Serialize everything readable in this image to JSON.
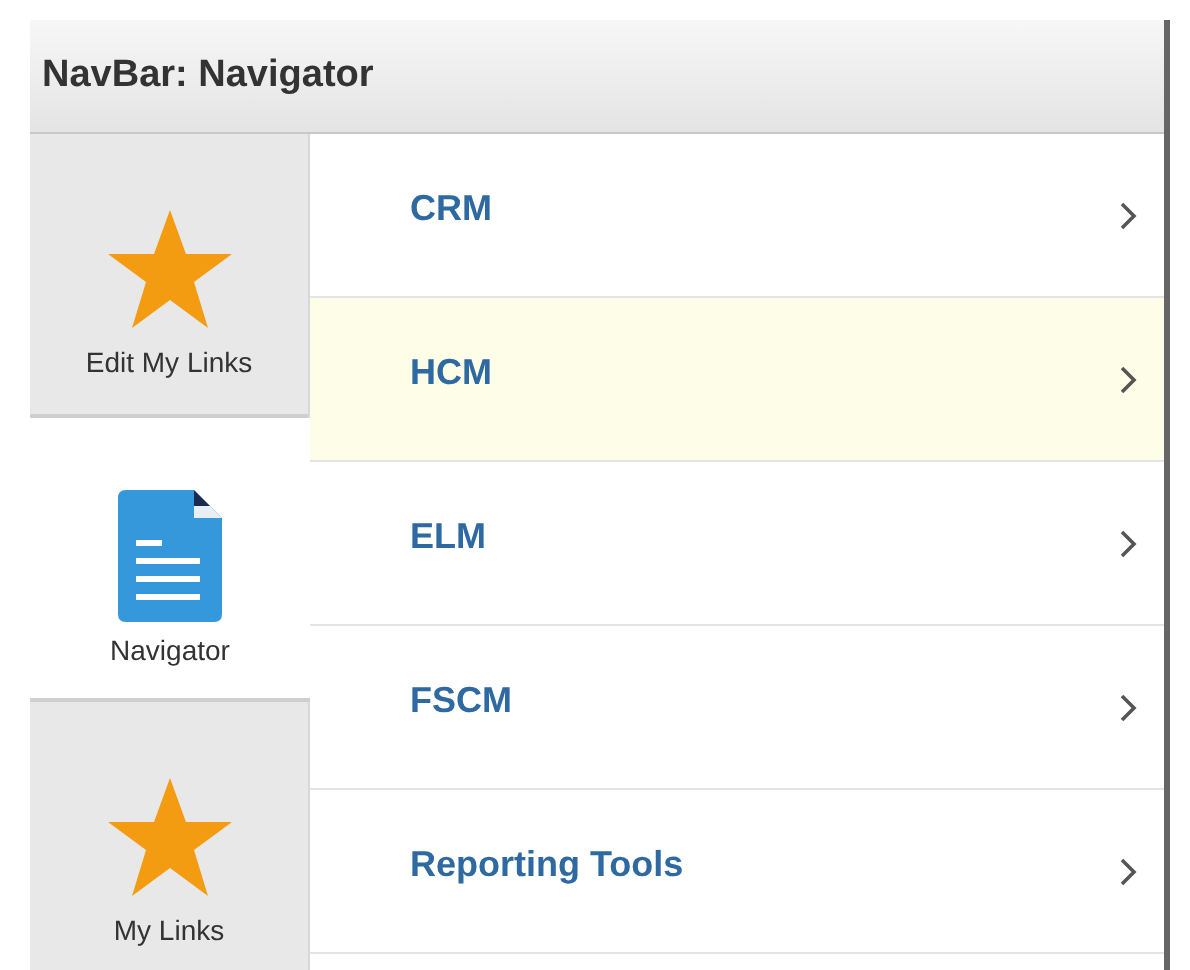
{
  "header": {
    "title": "NavBar: Navigator"
  },
  "tabs": [
    {
      "label": "Edit My Links",
      "kind": "star",
      "selected": false
    },
    {
      "label": "Navigator",
      "kind": "document",
      "selected": true
    },
    {
      "label": "My Links",
      "kind": "star",
      "selected": false
    }
  ],
  "menu_items": [
    {
      "label": "CRM",
      "highlighted": false
    },
    {
      "label": "HCM",
      "highlighted": true
    },
    {
      "label": "ELM",
      "highlighted": false
    },
    {
      "label": "FSCM",
      "highlighted": false
    },
    {
      "label": "Reporting Tools",
      "highlighted": false
    }
  ]
}
